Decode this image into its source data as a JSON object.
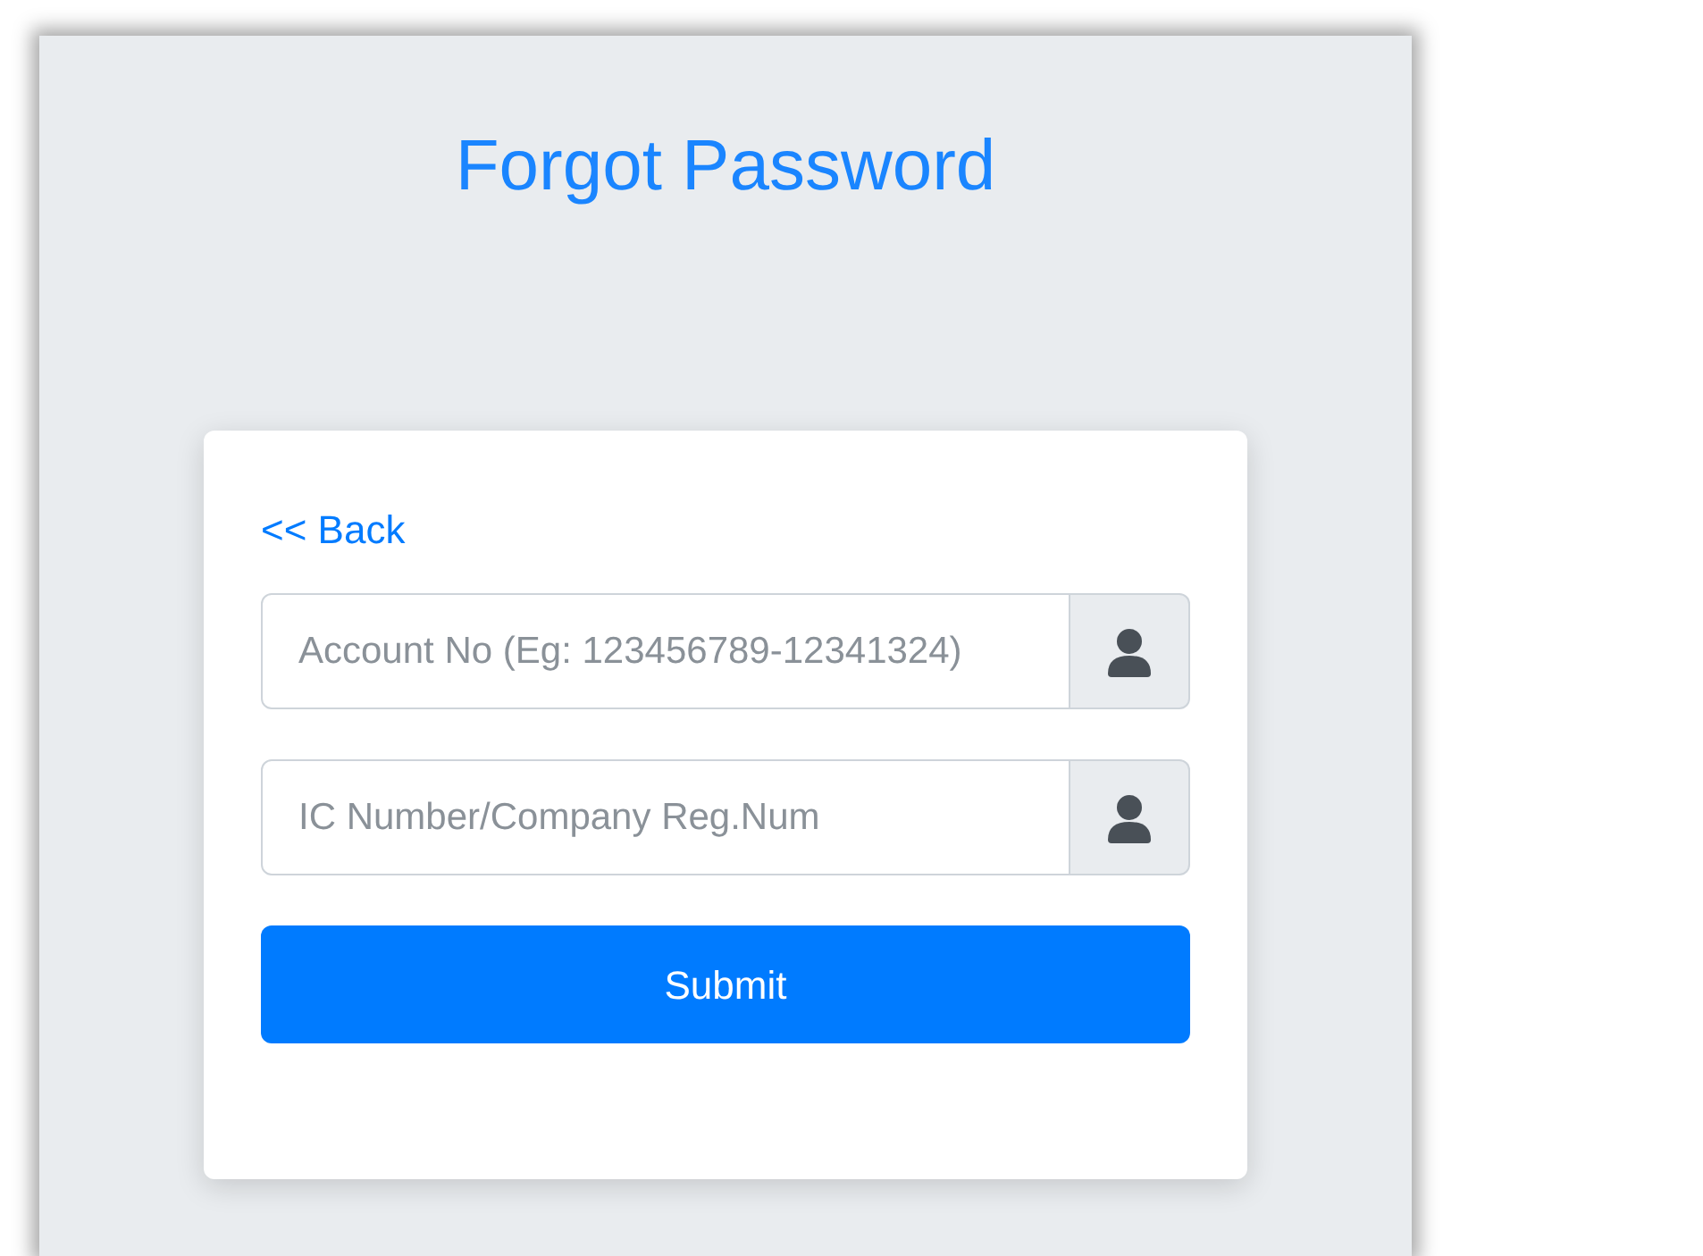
{
  "title": "Forgot Password",
  "back_link": "<< Back",
  "fields": [
    {
      "placeholder": "Account No (Eg: 123456789-12341324)"
    },
    {
      "placeholder": "IC Number/Company Reg.Num"
    }
  ],
  "submit_button": "Submit"
}
